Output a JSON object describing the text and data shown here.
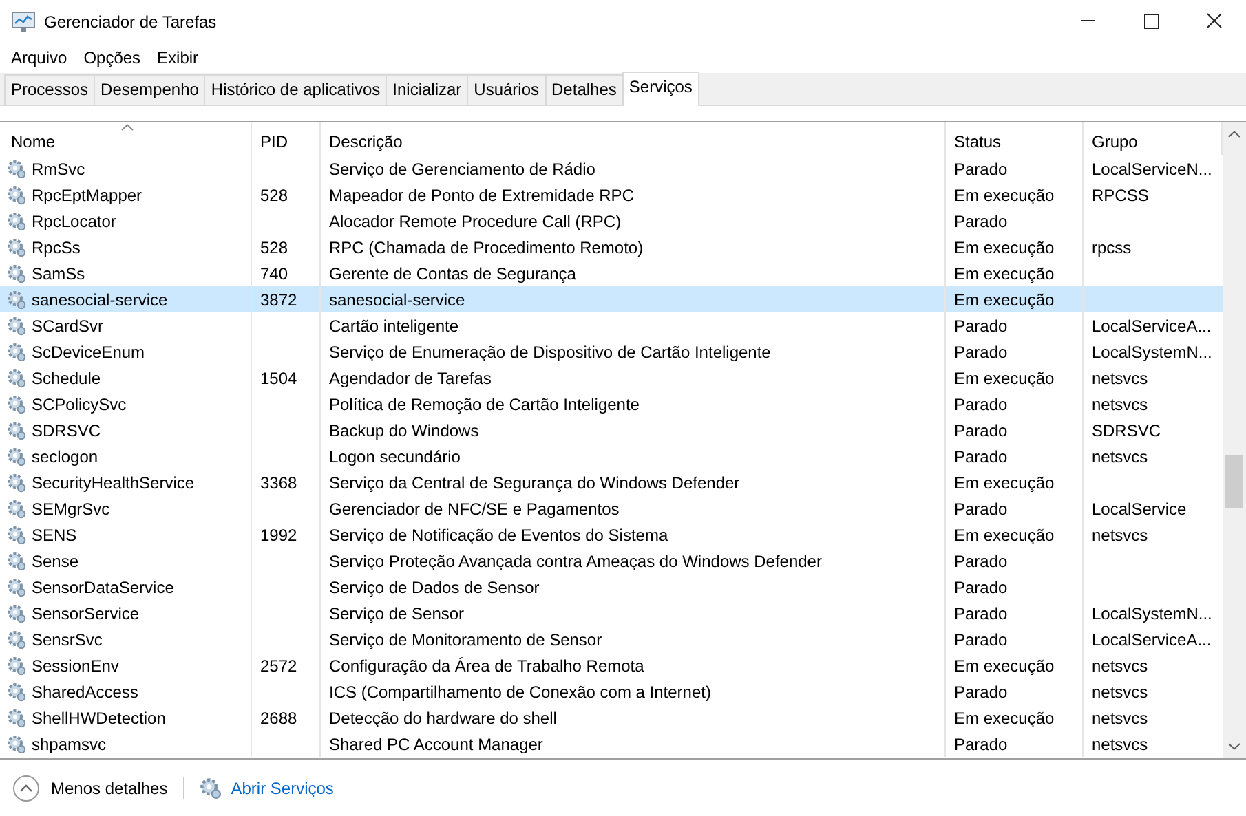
{
  "window": {
    "title": "Gerenciador de Tarefas"
  },
  "menu": [
    "Arquivo",
    "Opções",
    "Exibir"
  ],
  "tabs": [
    {
      "label": "Processos",
      "selected": false
    },
    {
      "label": "Desempenho",
      "selected": false
    },
    {
      "label": "Histórico de aplicativos",
      "selected": false
    },
    {
      "label": "Inicializar",
      "selected": false
    },
    {
      "label": "Usuários",
      "selected": false
    },
    {
      "label": "Detalhes",
      "selected": false
    },
    {
      "label": "Serviços",
      "selected": true
    }
  ],
  "table": {
    "columns": [
      "Nome",
      "PID",
      "Descrição",
      "Status",
      "Grupo"
    ],
    "rows": [
      {
        "name": "RmSvc",
        "description": "Serviço de Gerenciamento de Rádio",
        "status": "Parado",
        "group": "LocalServiceN...",
        "selected": false
      },
      {
        "name": "RpcEptMapper",
        "pid": "528",
        "description": "Mapeador de Ponto de Extremidade RPC",
        "status": "Em execução",
        "group": "RPCSS",
        "selected": false
      },
      {
        "name": "RpcLocator",
        "description": "Alocador Remote Procedure Call (RPC)",
        "status": "Parado",
        "selected": false
      },
      {
        "name": "RpcSs",
        "pid": "528",
        "description": "RPC (Chamada de Procedimento Remoto)",
        "status": "Em execução",
        "group": "rpcss",
        "selected": false
      },
      {
        "name": "SamSs",
        "pid": "740",
        "description": "Gerente de Contas de Segurança",
        "status": "Em execução",
        "selected": false
      },
      {
        "name": "sanesocial-service",
        "pid": "3872",
        "description": "sanesocial-service",
        "status": "Em execução",
        "selected": true
      },
      {
        "name": "SCardSvr",
        "description": "Cartão inteligente",
        "status": "Parado",
        "group": "LocalServiceA...",
        "selected": false
      },
      {
        "name": "ScDeviceEnum",
        "description": "Serviço de Enumeração de Dispositivo de Cartão Inteligente",
        "status": "Parado",
        "group": "LocalSystemN...",
        "selected": false
      },
      {
        "name": "Schedule",
        "pid": "1504",
        "description": "Agendador de Tarefas",
        "status": "Em execução",
        "group": "netsvcs",
        "selected": false
      },
      {
        "name": "SCPolicySvc",
        "description": "Política de Remoção de Cartão Inteligente",
        "status": "Parado",
        "group": "netsvcs",
        "selected": false
      },
      {
        "name": "SDRSVC",
        "description": "Backup do Windows",
        "status": "Parado",
        "group": "SDRSVC",
        "selected": false
      },
      {
        "name": "seclogon",
        "description": "Logon secundário",
        "status": "Parado",
        "group": "netsvcs",
        "selected": false
      },
      {
        "name": "SecurityHealthService",
        "pid": "3368",
        "description": "Serviço da Central de Segurança do Windows Defender",
        "status": "Em execução",
        "selected": false
      },
      {
        "name": "SEMgrSvc",
        "description": "Gerenciador de NFC/SE e Pagamentos",
        "status": "Parado",
        "group": "LocalService",
        "selected": false
      },
      {
        "name": "SENS",
        "pid": "1992",
        "description": "Serviço de Notificação de Eventos do Sistema",
        "status": "Em execução",
        "group": "netsvcs",
        "selected": false
      },
      {
        "name": "Sense",
        "description": "Serviço Proteção Avançada contra Ameaças do Windows Defender",
        "status": "Parado",
        "selected": false
      },
      {
        "name": "SensorDataService",
        "description": "Serviço de Dados de Sensor",
        "status": "Parado",
        "selected": false
      },
      {
        "name": "SensorService",
        "description": "Serviço de Sensor",
        "status": "Parado",
        "group": "LocalSystemN...",
        "selected": false
      },
      {
        "name": "SensrSvc",
        "description": "Serviço de Monitoramento de Sensor",
        "status": "Parado",
        "group": "LocalServiceA...",
        "selected": false
      },
      {
        "name": "SessionEnv",
        "pid": "2572",
        "description": "Configuração da Área de Trabalho Remota",
        "status": "Em execução",
        "group": "netsvcs",
        "selected": false
      },
      {
        "name": "SharedAccess",
        "description": "ICS (Compartilhamento de Conexão com a Internet)",
        "status": "Parado",
        "group": "netsvcs",
        "selected": false
      },
      {
        "name": "ShellHWDetection",
        "pid": "2688",
        "description": "Detecção do hardware do shell",
        "status": "Em execução",
        "group": "netsvcs",
        "selected": false
      },
      {
        "name": "shpamsvc",
        "description": "Shared PC Account Manager",
        "status": "Parado",
        "group": "netsvcs",
        "selected": false
      }
    ]
  },
  "footer": {
    "less_details": "Menos detalhes",
    "open_services": "Abrir Serviços"
  }
}
